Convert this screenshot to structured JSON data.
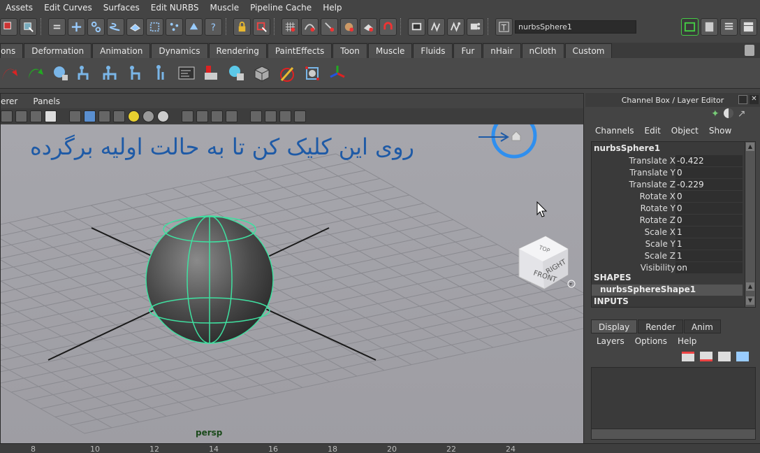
{
  "menubar": [
    "Assets",
    "Edit Curves",
    "Surfaces",
    "Edit NURBS",
    "Muscle",
    "Pipeline Cache",
    "Help"
  ],
  "toolbar": {
    "object_name": "nurbsSphere1"
  },
  "shelf": {
    "tabs": [
      "ons",
      "Deformation",
      "Animation",
      "Dynamics",
      "Rendering",
      "PaintEffects",
      "Toon",
      "Muscle",
      "Fluids",
      "Fur",
      "nHair",
      "nCloth",
      "Custom"
    ]
  },
  "viewport": {
    "menu": [
      "erer",
      "Panels"
    ],
    "camera_label": "persp",
    "annotation": "روی این کلیک کن تا به حالت اولیه برگرده",
    "viewcube": {
      "top": "TOP",
      "front": "FRONT",
      "right": "RIGHT"
    }
  },
  "channel_box": {
    "title": "Channel Box / Layer Editor",
    "menu": [
      "Channels",
      "Edit",
      "Object",
      "Show"
    ],
    "object": "nurbsSphere1",
    "attributes": [
      {
        "label": "Translate X",
        "value": "-0.422"
      },
      {
        "label": "Translate Y",
        "value": "0"
      },
      {
        "label": "Translate Z",
        "value": "-0.229"
      },
      {
        "label": "Rotate X",
        "value": "0"
      },
      {
        "label": "Rotate Y",
        "value": "0"
      },
      {
        "label": "Rotate Z",
        "value": "0"
      },
      {
        "label": "Scale X",
        "value": "1"
      },
      {
        "label": "Scale Y",
        "value": "1"
      },
      {
        "label": "Scale Z",
        "value": "1"
      },
      {
        "label": "Visibility",
        "value": "on"
      }
    ],
    "shapes_label": "SHAPES",
    "shape_name": "nurbsSphereShape1",
    "inputs_label": "INPUTS"
  },
  "layer_editor": {
    "tabs": [
      "Display",
      "Render",
      "Anim"
    ],
    "menu": [
      "Layers",
      "Options",
      "Help"
    ]
  },
  "timeline": {
    "ticks": [
      "8",
      "10",
      "12",
      "14",
      "16",
      "18",
      "20",
      "22",
      "24"
    ]
  },
  "colors": {
    "annotation": "#1e5aa6",
    "highlight_ring": "#2f8fef",
    "wireframe": "#3fe0a0"
  }
}
